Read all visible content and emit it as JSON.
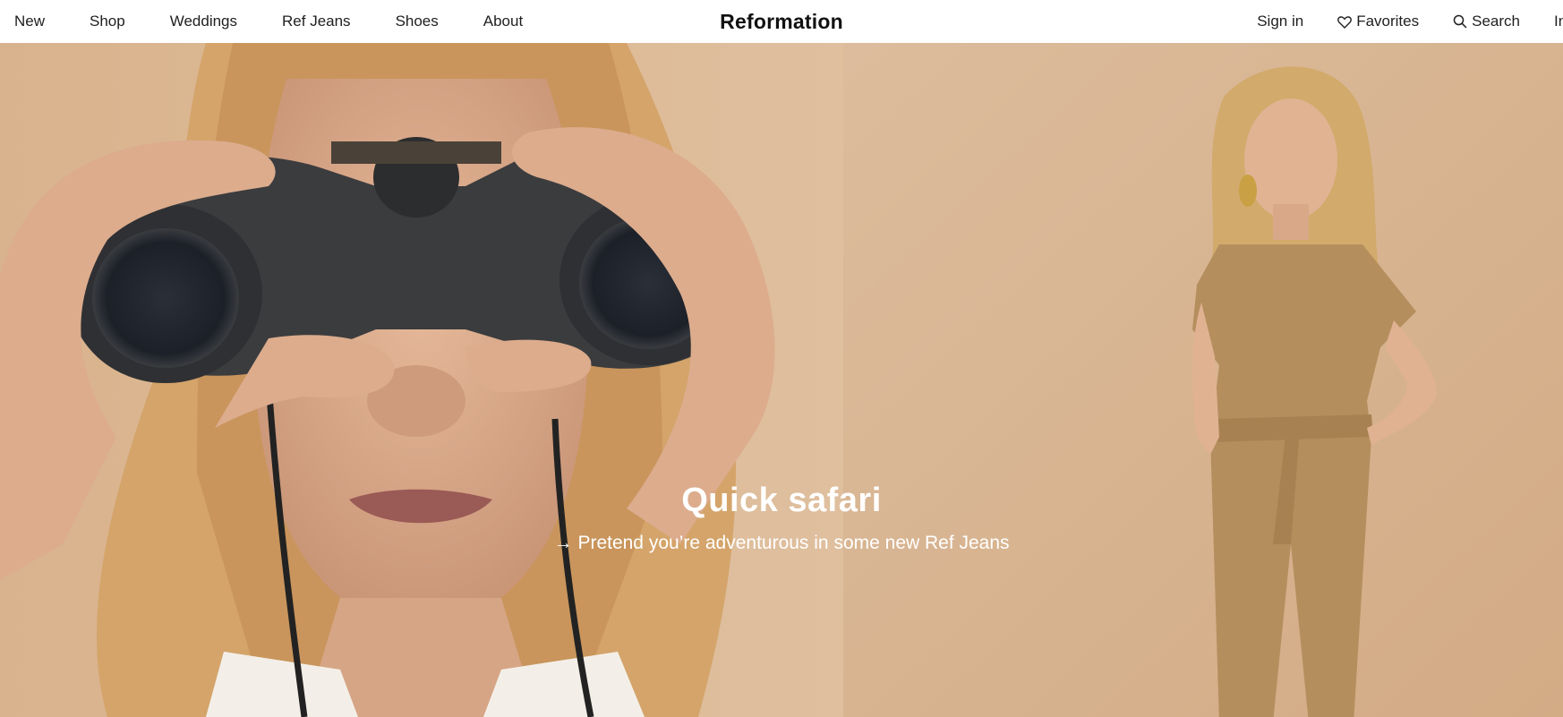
{
  "header": {
    "nav_left": [
      {
        "label": "New"
      },
      {
        "label": "Shop"
      },
      {
        "label": "Weddings"
      },
      {
        "label": "Ref Jeans"
      },
      {
        "label": "Shoes"
      },
      {
        "label": "About"
      }
    ],
    "brand": "Reformation",
    "nav_right": {
      "sign_in": "Sign in",
      "favorites": "Favorites",
      "search": "Search",
      "overflow": "In"
    }
  },
  "hero": {
    "title": "Quick safari",
    "link_arrow": "→",
    "link_text": "Pretend you’re adventurous in some new Ref Jeans",
    "left_image": "woman-with-binoculars-photo",
    "right_image": "woman-in-tan-jumpsuit-photo"
  },
  "colors": {
    "hero_background": "#d9b591",
    "text_on_hero": "#ffffff",
    "header_background": "#ffffff"
  }
}
